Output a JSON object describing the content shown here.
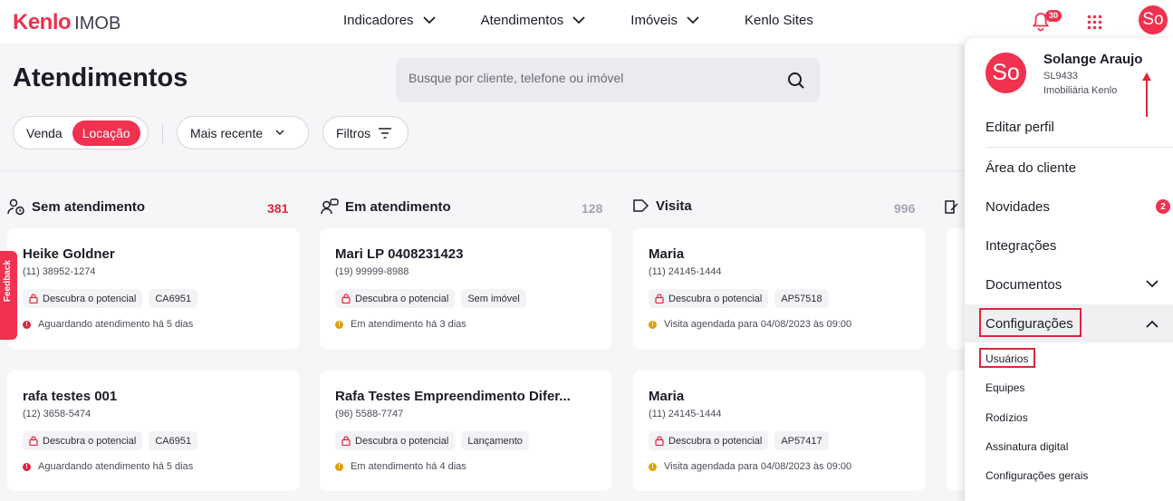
{
  "header": {
    "logo_brand": "Kenlo",
    "logo_product": "IMOB",
    "nav": [
      {
        "label": "Indicadores",
        "has_dropdown": true
      },
      {
        "label": "Atendimentos",
        "has_dropdown": true
      },
      {
        "label": "Imóveis",
        "has_dropdown": true
      },
      {
        "label": "Kenlo Sites",
        "has_dropdown": false
      }
    ],
    "notifications_count": "30",
    "avatar_initials": "So"
  },
  "page": {
    "title": "Atendimentos",
    "search_placeholder": "Busque por cliente, telefone ou imóvel",
    "segment": [
      "Venda",
      "Locação"
    ],
    "segment_active": "Locação",
    "sort_label": "Mais recente",
    "filters_label": "Filtros"
  },
  "feedback_label": "Feedback",
  "columns": [
    {
      "title": "Sem atendimento",
      "count": "381",
      "icon": "user-clock-icon",
      "cards": [
        {
          "name": "Heike Goldner",
          "phone": "(11) 38952-1274",
          "tags": [
            "Descubra o potencial",
            "CA6951"
          ],
          "status": "Aguardando atendimento há 5 dias",
          "status_color": "#e0243d"
        },
        {
          "name": "rafa testes 001",
          "phone": "(12) 3658-5474",
          "tags": [
            "Descubra o potencial",
            "CA6951"
          ],
          "status": "Aguardando atendimento há 5 dias",
          "status_color": "#e0243d"
        }
      ]
    },
    {
      "title": "Em atendimento",
      "count": "128",
      "icon": "user-chat-icon",
      "cards": [
        {
          "name": "Mari LP 0408231423",
          "phone": "(19) 99999-8988",
          "tags": [
            "Descubra o potencial",
            "Sem imóvel"
          ],
          "status": "Em atendimento há 3 dias",
          "status_color": "#e0a000"
        },
        {
          "name": "Rafa Testes Empreendimento Difer...",
          "phone": "(96) 5588-7747",
          "tags": [
            "Descubra o potencial",
            "Lançamento"
          ],
          "status": "Em atendimento há 4 dias",
          "status_color": "#e0a000"
        }
      ]
    },
    {
      "title": "Visita",
      "count": "996",
      "icon": "tag-icon",
      "cards": [
        {
          "name": "Maria",
          "phone": "(11) 24145-1444",
          "tags": [
            "Descubra o potencial",
            "AP57518"
          ],
          "status": "Visita agendada para 04/08/2023 às 09:00",
          "status_color": "#e0a000"
        },
        {
          "name": "Maria",
          "phone": "(11) 24145-1444",
          "tags": [
            "Descubra o potencial",
            "AP57417"
          ],
          "status": "Visita agendada para 04/08/2023 às 09:00",
          "status_color": "#e0a000"
        }
      ]
    }
  ],
  "user_menu": {
    "avatar_initials": "So",
    "name": "Solange Araujo",
    "code": "SL9433",
    "org": "Imobiliária Kenlo",
    "edit_profile": "Editar perfil",
    "items": [
      {
        "label": "Área do cliente"
      },
      {
        "label": "Novidades",
        "badge": "2"
      },
      {
        "label": "Integrações"
      },
      {
        "label": "Documentos"
      }
    ],
    "settings_label": "Configurações",
    "settings_sub": [
      "Usuários",
      "Equipes",
      "Rodízios",
      "Assinatura digital",
      "Configurações gerais"
    ],
    "accent": "#f0314f",
    "highlight": "#e0243d"
  }
}
